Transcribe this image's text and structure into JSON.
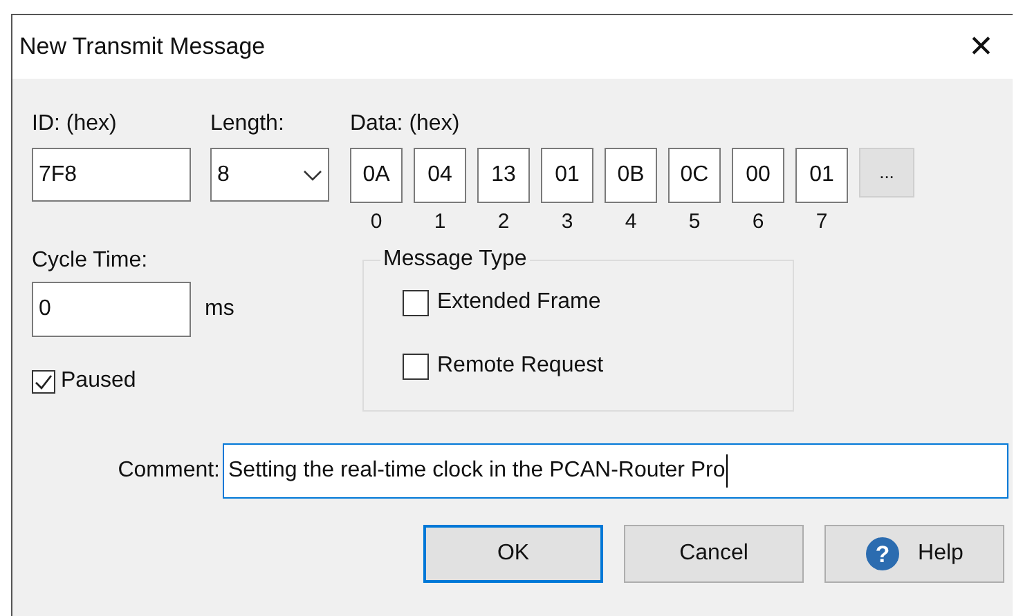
{
  "window": {
    "title": "New Transmit Message",
    "close": "✕"
  },
  "id": {
    "label": "ID: (hex)",
    "value": "7F8"
  },
  "length": {
    "label": "Length:",
    "value": "8"
  },
  "data": {
    "label": "Data: (hex)",
    "more": "...",
    "bytes": [
      {
        "value": "0A",
        "index": "0"
      },
      {
        "value": "04",
        "index": "1"
      },
      {
        "value": "13",
        "index": "2"
      },
      {
        "value": "01",
        "index": "3"
      },
      {
        "value": "0B",
        "index": "4"
      },
      {
        "value": "0C",
        "index": "5"
      },
      {
        "value": "00",
        "index": "6"
      },
      {
        "value": "01",
        "index": "7"
      }
    ]
  },
  "cycle_time": {
    "label": "Cycle Time:",
    "value": "0",
    "unit": "ms"
  },
  "paused": {
    "label": "Paused",
    "checked": true
  },
  "message_type": {
    "title": "Message Type",
    "options": [
      {
        "label": "Extended Frame",
        "checked": false
      },
      {
        "label": "Remote Request",
        "checked": false
      }
    ]
  },
  "comment": {
    "label": "Comment:",
    "value": "Setting the real-time clock in the PCAN-Router Pro"
  },
  "buttons": [
    {
      "kind": "default",
      "label": "OK"
    },
    {
      "kind": "plain",
      "label": "Cancel"
    },
    {
      "kind": "help",
      "label": "Help",
      "icon": "?"
    }
  ]
}
